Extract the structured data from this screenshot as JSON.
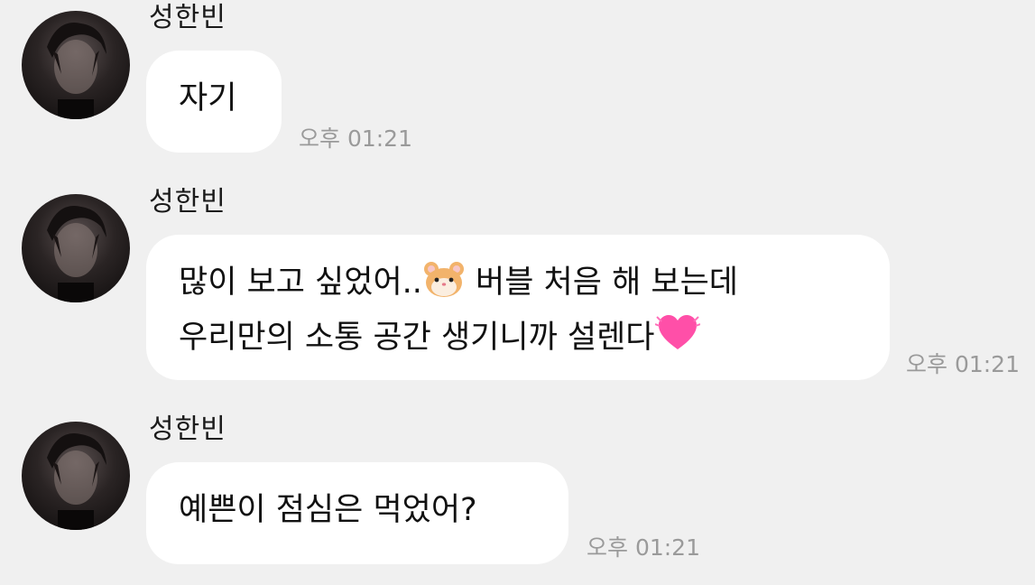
{
  "messages": [
    {
      "sender": "성한빈",
      "lines": [
        "자기"
      ],
      "time": "오후 01:21"
    },
    {
      "sender": "성한빈",
      "lines_parts": [
        [
          "많이 보고 싶었어..",
          "hamster-emoji",
          " 버블 처음 해 보는데"
        ],
        [
          "우리만의 소통 공간 생기니까 설렌다",
          "heart-emoji"
        ]
      ],
      "line1_before": "많이 보고 싶었어..",
      "line1_after": " 버블 처음 해 보는데",
      "line2_before": "우리만의 소통 공간 생기니까 설렌다",
      "time": "오후 01:21"
    },
    {
      "sender": "성한빈",
      "lines": [
        "예쁜이 점심은 먹었어?"
      ],
      "time": "오후 01:21"
    }
  ],
  "icons": {
    "avatar": "profile-photo",
    "emoji_1": "hamster-face-emoji",
    "emoji_2": "beating-heart-emoji"
  },
  "colors": {
    "background": "#f0f0f0",
    "bubble": "#ffffff",
    "time_text": "#9a9a9a",
    "heart": "#ff4fa8",
    "hamster": "#f2b36b"
  }
}
